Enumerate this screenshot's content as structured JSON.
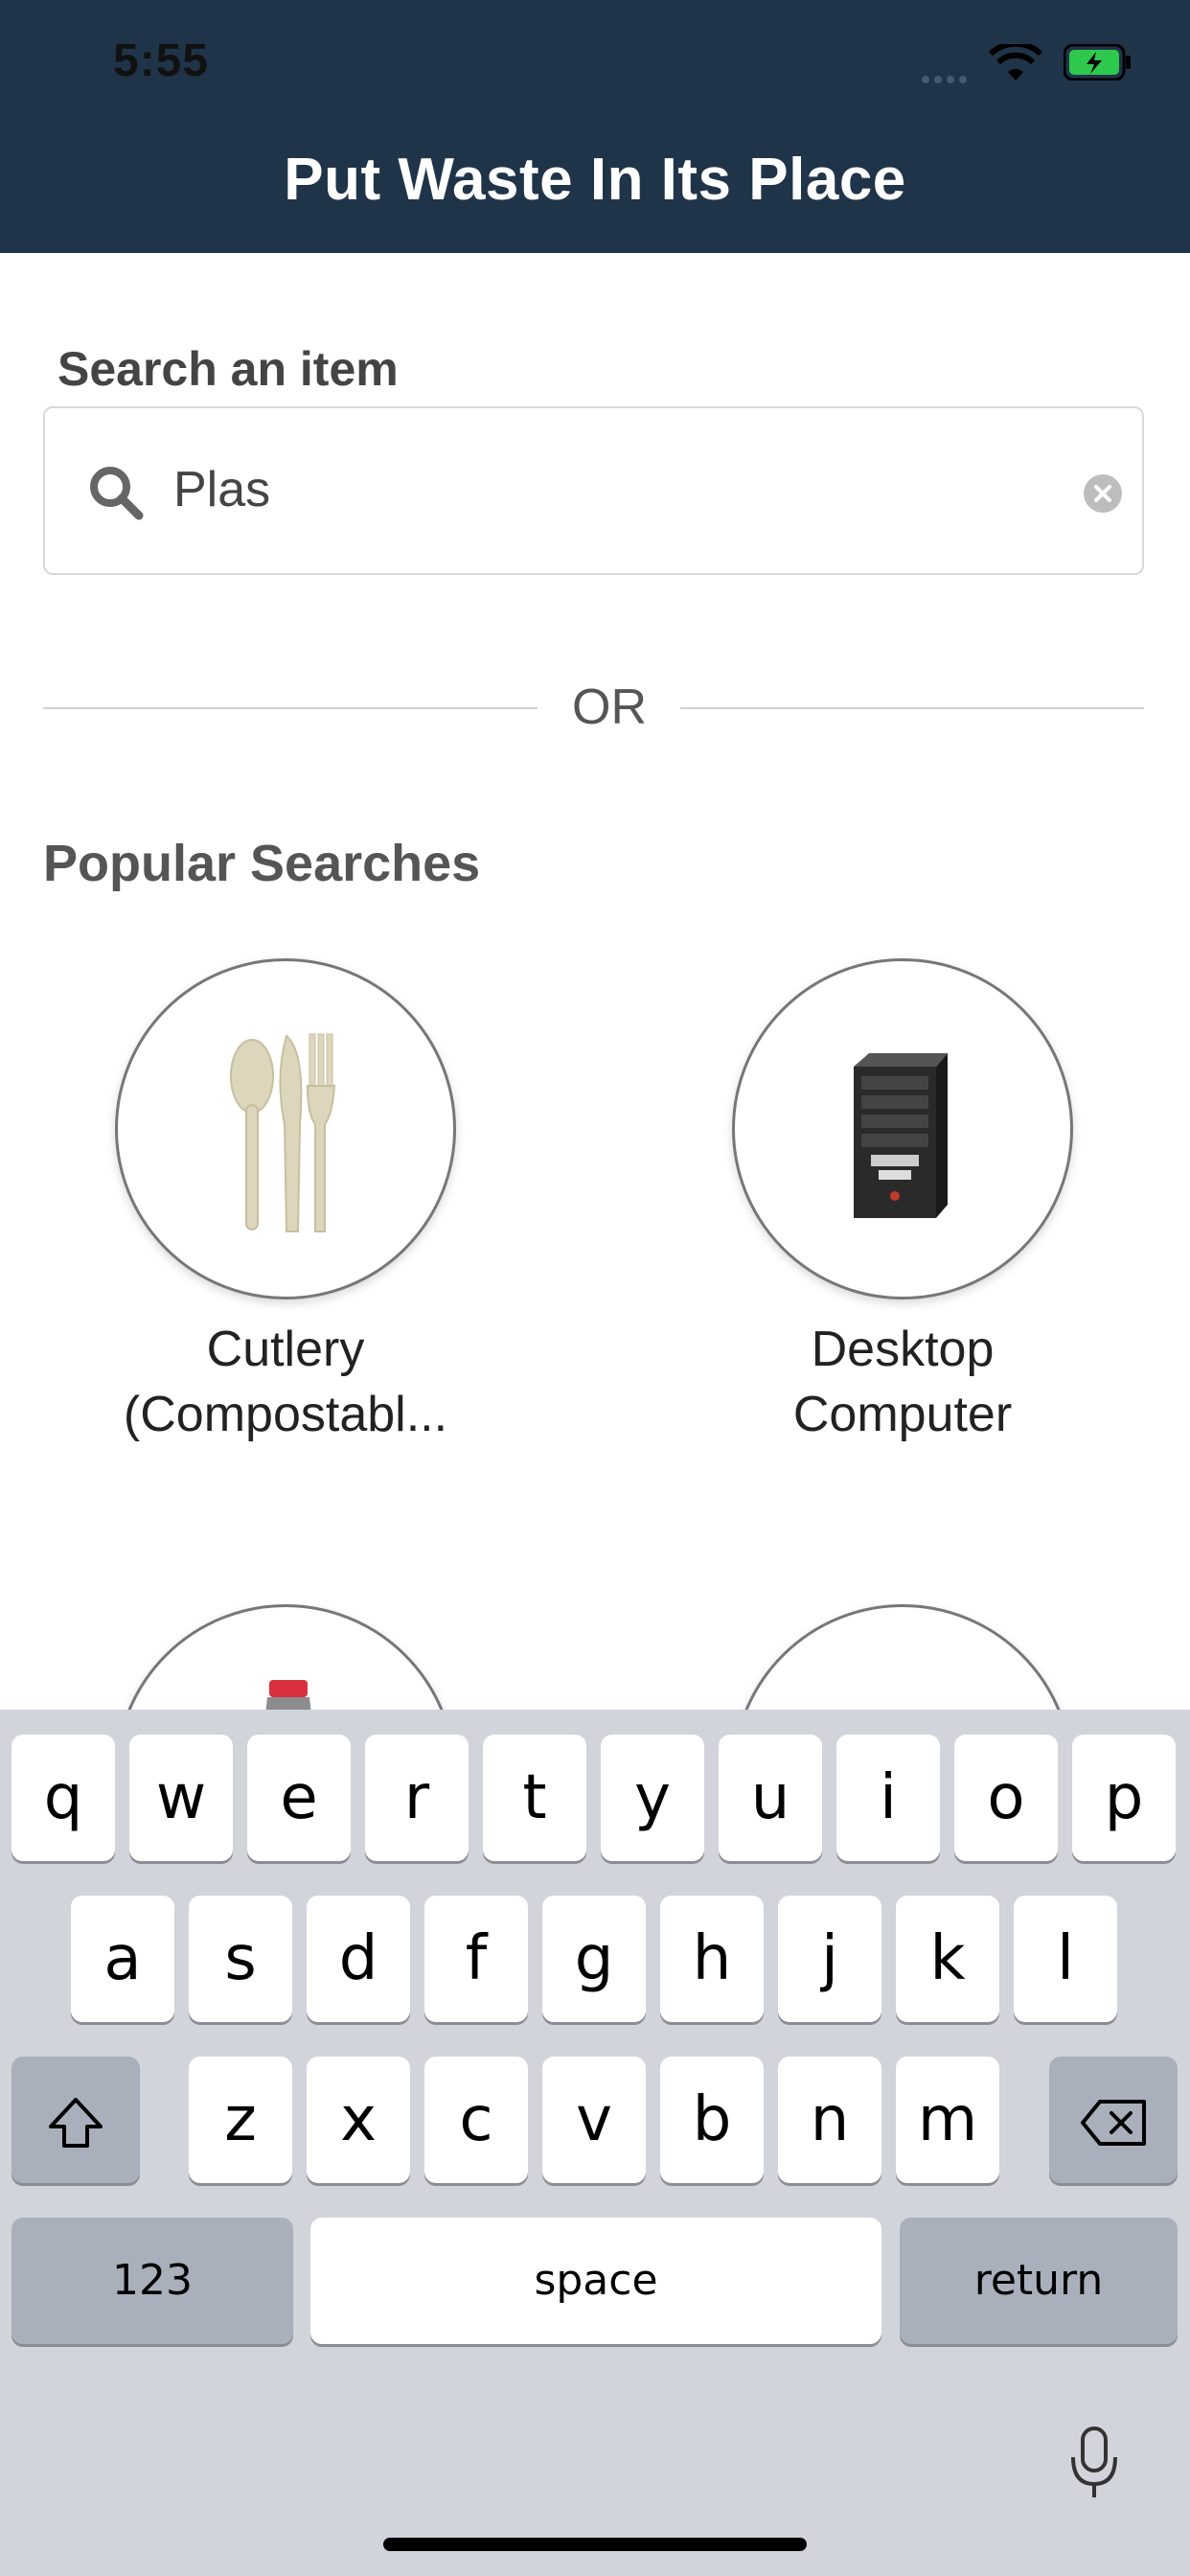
{
  "status": {
    "time": "5:55"
  },
  "header": {
    "title": "Put Waste In Its Place"
  },
  "search": {
    "label": "Search an item",
    "value": "Plas"
  },
  "divider": {
    "text": "OR"
  },
  "popular": {
    "title": "Popular Searches",
    "items": [
      {
        "label_line1": "Cutlery",
        "label_line2": "(Compostabl..."
      },
      {
        "label_line1": "Desktop",
        "label_line2": "Computer"
      }
    ]
  },
  "keyboard": {
    "row1": [
      "q",
      "w",
      "e",
      "r",
      "t",
      "y",
      "u",
      "i",
      "o",
      "p"
    ],
    "row2": [
      "a",
      "s",
      "d",
      "f",
      "g",
      "h",
      "j",
      "k",
      "l"
    ],
    "row3": [
      "z",
      "x",
      "c",
      "v",
      "b",
      "n",
      "m"
    ],
    "numbers_label": "123",
    "space_label": "space",
    "return_label": "return"
  },
  "colors": {
    "header_bg": "#203449",
    "keyboard_bg": "#d1d4da"
  },
  "icons": [
    "search-icon",
    "clear-icon",
    "wifi-icon",
    "battery-icon",
    "shift-icon",
    "backspace-icon",
    "mic-icon"
  ]
}
